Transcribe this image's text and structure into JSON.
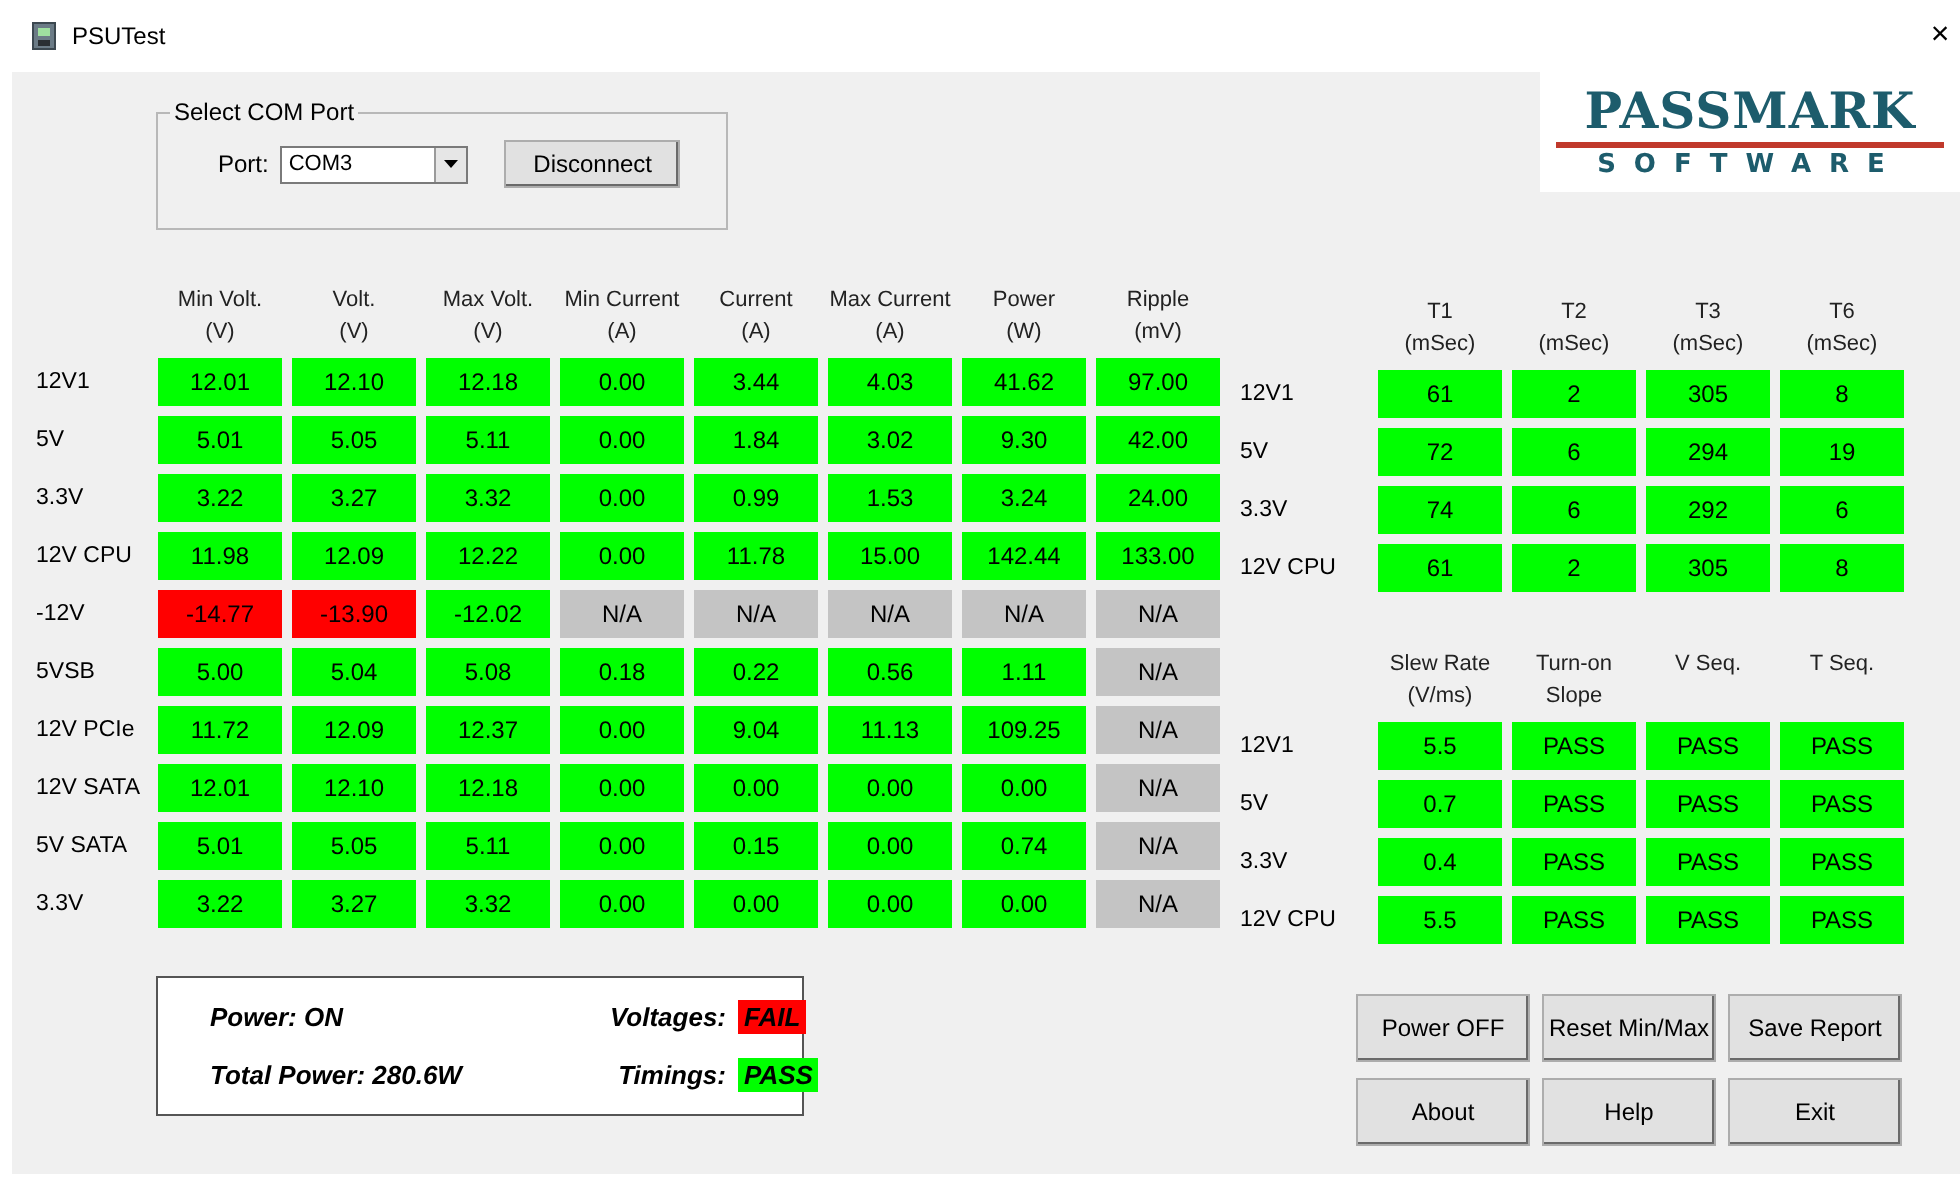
{
  "window": {
    "title": "PSUTest",
    "close": "×"
  },
  "com_port": {
    "group_title": "Select COM Port",
    "port_label": "Port:",
    "port_value": "COM3",
    "button": "Disconnect"
  },
  "logo": {
    "name": "PASSMARK",
    "tagline": "SOFTWARE"
  },
  "readings": {
    "columns": [
      {
        "title": "Min Volt.",
        "unit": "(V)"
      },
      {
        "title": "Volt.",
        "unit": "(V)"
      },
      {
        "title": "Max Volt.",
        "unit": "(V)"
      },
      {
        "title": "Min Current",
        "unit": "(A)"
      },
      {
        "title": "Current",
        "unit": "(A)"
      },
      {
        "title": "Max Current",
        "unit": "(A)"
      },
      {
        "title": "Power",
        "unit": "(W)"
      },
      {
        "title": "Ripple",
        "unit": "(mV)"
      }
    ],
    "rows": [
      {
        "label": "12V1",
        "cells": [
          {
            "value": "12.01",
            "color": "#00ff00"
          },
          {
            "value": "12.10",
            "color": "#00ff00"
          },
          {
            "value": "12.18",
            "color": "#00ff00"
          },
          {
            "value": "0.00",
            "color": "#00ff00"
          },
          {
            "value": "3.44",
            "color": "#00ff00"
          },
          {
            "value": "4.03",
            "color": "#00ff00"
          },
          {
            "value": "41.62",
            "color": "#00ff00"
          },
          {
            "value": "97.00",
            "color": "#00ff00"
          }
        ]
      },
      {
        "label": "5V",
        "cells": [
          {
            "value": "5.01",
            "color": "#00ff00"
          },
          {
            "value": "5.05",
            "color": "#00ff00"
          },
          {
            "value": "5.11",
            "color": "#00ff00"
          },
          {
            "value": "0.00",
            "color": "#00ff00"
          },
          {
            "value": "1.84",
            "color": "#00ff00"
          },
          {
            "value": "3.02",
            "color": "#00ff00"
          },
          {
            "value": "9.30",
            "color": "#00ff00"
          },
          {
            "value": "42.00",
            "color": "#00ff00"
          }
        ]
      },
      {
        "label": "3.3V",
        "cells": [
          {
            "value": "3.22",
            "color": "#00ff00"
          },
          {
            "value": "3.27",
            "color": "#00ff00"
          },
          {
            "value": "3.32",
            "color": "#00ff00"
          },
          {
            "value": "0.00",
            "color": "#00ff00"
          },
          {
            "value": "0.99",
            "color": "#00ff00"
          },
          {
            "value": "1.53",
            "color": "#00ff00"
          },
          {
            "value": "3.24",
            "color": "#00ff00"
          },
          {
            "value": "24.00",
            "color": "#00ff00"
          }
        ]
      },
      {
        "label": "12V CPU",
        "cells": [
          {
            "value": "11.98",
            "color": "#00ff00"
          },
          {
            "value": "12.09",
            "color": "#00ff00"
          },
          {
            "value": "12.22",
            "color": "#00ff00"
          },
          {
            "value": "0.00",
            "color": "#00ff00"
          },
          {
            "value": "11.78",
            "color": "#00ff00"
          },
          {
            "value": "15.00",
            "color": "#00ff00"
          },
          {
            "value": "142.44",
            "color": "#00ff00"
          },
          {
            "value": "133.00",
            "color": "#00ff00"
          }
        ]
      },
      {
        "label": "-12V",
        "cells": [
          {
            "value": "-14.77",
            "color": "#ff0000"
          },
          {
            "value": "-13.90",
            "color": "#ff0000"
          },
          {
            "value": "-12.02",
            "color": "#00ff00"
          },
          {
            "value": "N/A",
            "color": "#c4c4c4"
          },
          {
            "value": "N/A",
            "color": "#c4c4c4"
          },
          {
            "value": "N/A",
            "color": "#c4c4c4"
          },
          {
            "value": "N/A",
            "color": "#c4c4c4"
          },
          {
            "value": "N/A",
            "color": "#c4c4c4"
          }
        ]
      },
      {
        "label": "5VSB",
        "cells": [
          {
            "value": "5.00",
            "color": "#00ff00"
          },
          {
            "value": "5.04",
            "color": "#00ff00"
          },
          {
            "value": "5.08",
            "color": "#00ff00"
          },
          {
            "value": "0.18",
            "color": "#00ff00"
          },
          {
            "value": "0.22",
            "color": "#00ff00"
          },
          {
            "value": "0.56",
            "color": "#00ff00"
          },
          {
            "value": "1.11",
            "color": "#00ff00"
          },
          {
            "value": "N/A",
            "color": "#c4c4c4"
          }
        ]
      },
      {
        "label": "12V PCIe",
        "cells": [
          {
            "value": "11.72",
            "color": "#00ff00"
          },
          {
            "value": "12.09",
            "color": "#00ff00"
          },
          {
            "value": "12.37",
            "color": "#00ff00"
          },
          {
            "value": "0.00",
            "color": "#00ff00"
          },
          {
            "value": "9.04",
            "color": "#00ff00"
          },
          {
            "value": "11.13",
            "color": "#00ff00"
          },
          {
            "value": "109.25",
            "color": "#00ff00"
          },
          {
            "value": "N/A",
            "color": "#c4c4c4"
          }
        ]
      },
      {
        "label": "12V SATA",
        "cells": [
          {
            "value": "12.01",
            "color": "#00ff00"
          },
          {
            "value": "12.10",
            "color": "#00ff00"
          },
          {
            "value": "12.18",
            "color": "#00ff00"
          },
          {
            "value": "0.00",
            "color": "#00ff00"
          },
          {
            "value": "0.00",
            "color": "#00ff00"
          },
          {
            "value": "0.00",
            "color": "#00ff00"
          },
          {
            "value": "0.00",
            "color": "#00ff00"
          },
          {
            "value": "N/A",
            "color": "#c4c4c4"
          }
        ]
      },
      {
        "label": "5V SATA",
        "cells": [
          {
            "value": "5.01",
            "color": "#00ff00"
          },
          {
            "value": "5.05",
            "color": "#00ff00"
          },
          {
            "value": "5.11",
            "color": "#00ff00"
          },
          {
            "value": "0.00",
            "color": "#00ff00"
          },
          {
            "value": "0.15",
            "color": "#00ff00"
          },
          {
            "value": "0.00",
            "color": "#00ff00"
          },
          {
            "value": "0.74",
            "color": "#00ff00"
          },
          {
            "value": "N/A",
            "color": "#c4c4c4"
          }
        ]
      },
      {
        "label": "3.3V",
        "cells": [
          {
            "value": "3.22",
            "color": "#00ff00"
          },
          {
            "value": "3.27",
            "color": "#00ff00"
          },
          {
            "value": "3.32",
            "color": "#00ff00"
          },
          {
            "value": "0.00",
            "color": "#00ff00"
          },
          {
            "value": "0.00",
            "color": "#00ff00"
          },
          {
            "value": "0.00",
            "color": "#00ff00"
          },
          {
            "value": "0.00",
            "color": "#00ff00"
          },
          {
            "value": "N/A",
            "color": "#c4c4c4"
          }
        ]
      }
    ]
  },
  "timings": {
    "columns": [
      {
        "title": "T1",
        "unit": "(mSec)"
      },
      {
        "title": "T2",
        "unit": "(mSec)"
      },
      {
        "title": "T3",
        "unit": "(mSec)"
      },
      {
        "title": "T6",
        "unit": "(mSec)"
      }
    ],
    "rows": [
      {
        "label": "12V1",
        "cells": [
          {
            "value": "61",
            "color": "#00ff00"
          },
          {
            "value": "2",
            "color": "#00ff00"
          },
          {
            "value": "305",
            "color": "#00ff00"
          },
          {
            "value": "8",
            "color": "#00ff00"
          }
        ]
      },
      {
        "label": "5V",
        "cells": [
          {
            "value": "72",
            "color": "#00ff00"
          },
          {
            "value": "6",
            "color": "#00ff00"
          },
          {
            "value": "294",
            "color": "#00ff00"
          },
          {
            "value": "19",
            "color": "#00ff00"
          }
        ]
      },
      {
        "label": "3.3V",
        "cells": [
          {
            "value": "74",
            "color": "#00ff00"
          },
          {
            "value": "6",
            "color": "#00ff00"
          },
          {
            "value": "292",
            "color": "#00ff00"
          },
          {
            "value": "6",
            "color": "#00ff00"
          }
        ]
      },
      {
        "label": "12V CPU",
        "cells": [
          {
            "value": "61",
            "color": "#00ff00"
          },
          {
            "value": "2",
            "color": "#00ff00"
          },
          {
            "value": "305",
            "color": "#00ff00"
          },
          {
            "value": "8",
            "color": "#00ff00"
          }
        ]
      }
    ]
  },
  "sequencing": {
    "columns": [
      {
        "title": "Slew Rate",
        "unit": "(V/ms)"
      },
      {
        "title": "Turn-on",
        "unit": "Slope"
      },
      {
        "title": "V Seq."
      },
      {
        "title": "T Seq."
      }
    ],
    "rows": [
      {
        "label": "12V1",
        "cells": [
          {
            "value": "5.5",
            "color": "#00ff00"
          },
          {
            "value": "PASS",
            "color": "#00ff00"
          },
          {
            "value": "PASS",
            "color": "#00ff00"
          },
          {
            "value": "PASS",
            "color": "#00ff00"
          }
        ]
      },
      {
        "label": "5V",
        "cells": [
          {
            "value": "0.7",
            "color": "#00ff00"
          },
          {
            "value": "PASS",
            "color": "#00ff00"
          },
          {
            "value": "PASS",
            "color": "#00ff00"
          },
          {
            "value": "PASS",
            "color": "#00ff00"
          }
        ]
      },
      {
        "label": "3.3V",
        "cells": [
          {
            "value": "0.4",
            "color": "#00ff00"
          },
          {
            "value": "PASS",
            "color": "#00ff00"
          },
          {
            "value": "PASS",
            "color": "#00ff00"
          },
          {
            "value": "PASS",
            "color": "#00ff00"
          }
        ]
      },
      {
        "label": "12V CPU",
        "cells": [
          {
            "value": "5.5",
            "color": "#00ff00"
          },
          {
            "value": "PASS",
            "color": "#00ff00"
          },
          {
            "value": "PASS",
            "color": "#00ff00"
          },
          {
            "value": "PASS",
            "color": "#00ff00"
          }
        ]
      }
    ]
  },
  "summary": {
    "power": "Power: ON",
    "total_power": "Total Power: 280.6W",
    "voltages": {
      "label": "Voltages:",
      "value": "FAIL",
      "color": "#ff0000"
    },
    "timings": {
      "label": "Timings:",
      "value": "PASS",
      "color": "#00ff00"
    }
  },
  "buttons": [
    "Power OFF",
    "Reset Min/Max",
    "Save Report",
    "About",
    "Help",
    "Exit"
  ]
}
